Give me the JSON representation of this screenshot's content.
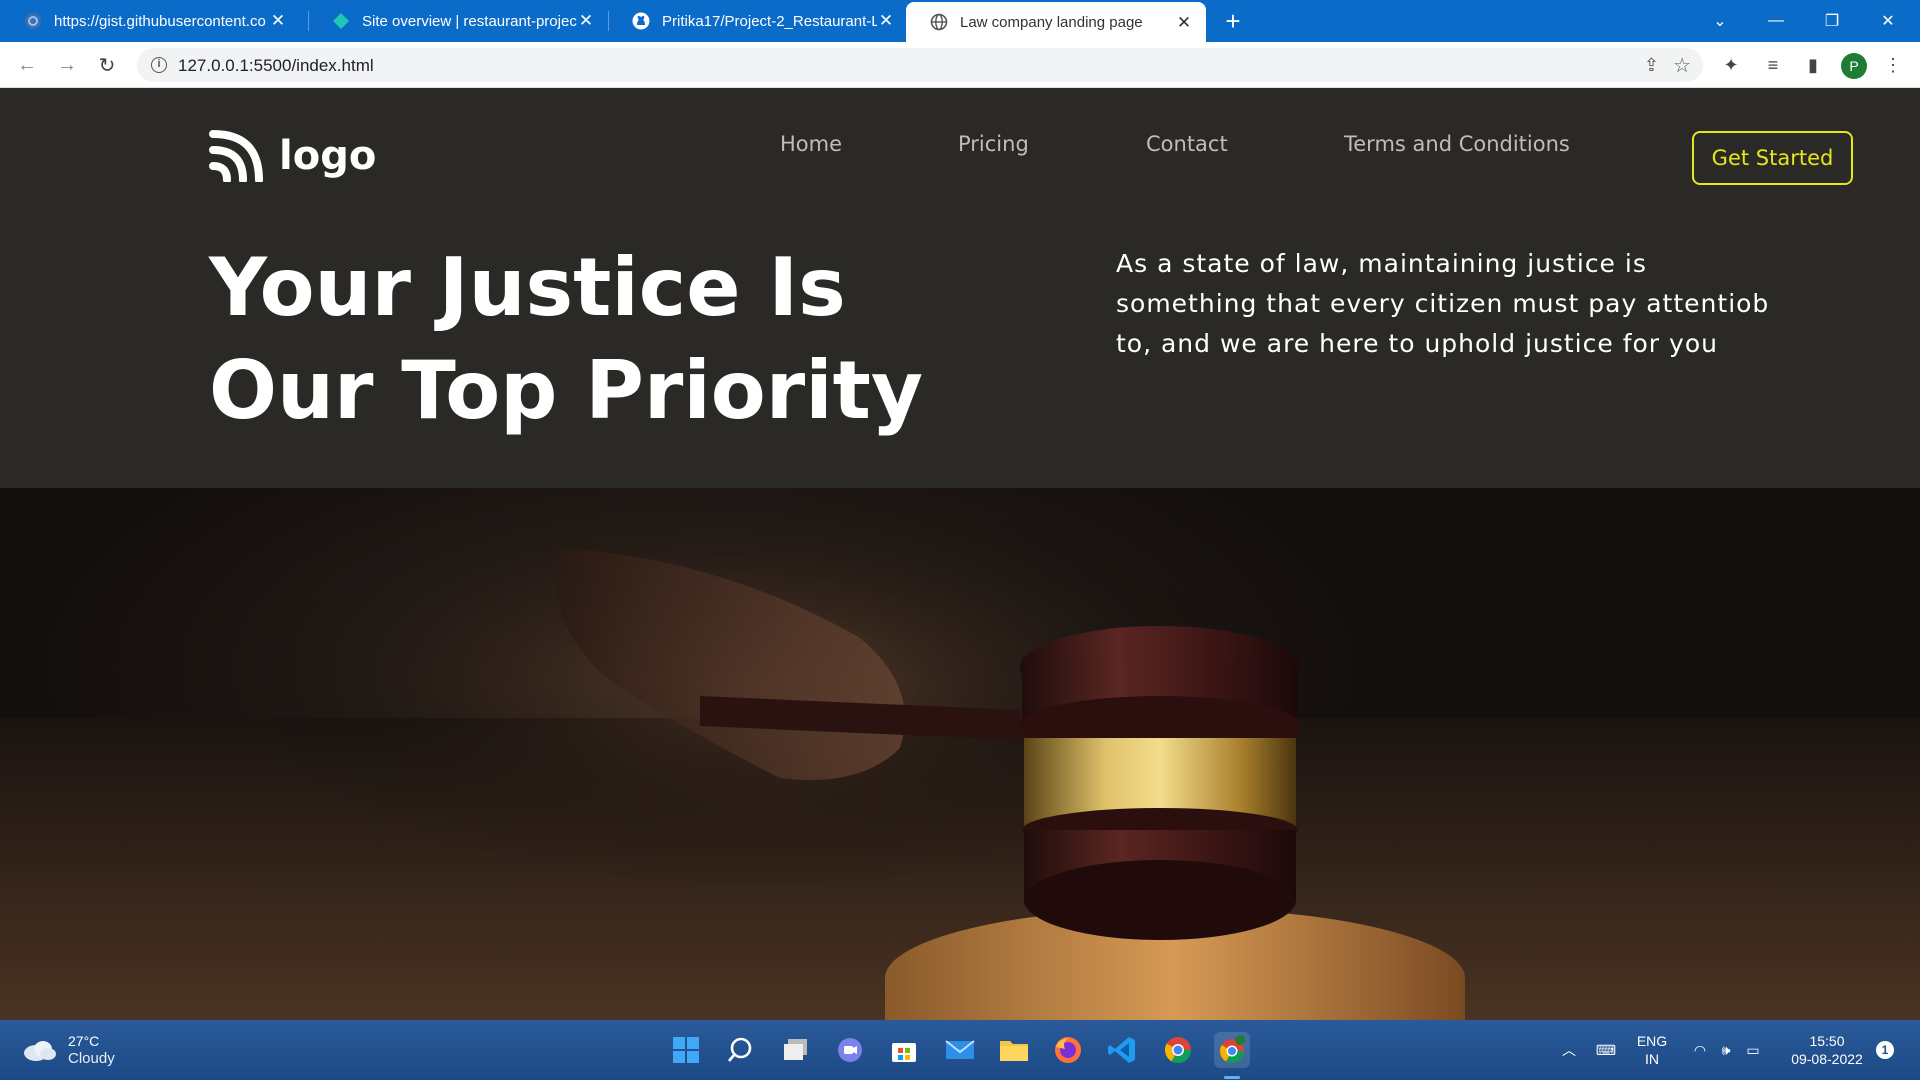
{
  "browser": {
    "tabs": [
      {
        "title": "https://gist.githubusercontent.co",
        "active": false,
        "favicon": "gist-icon"
      },
      {
        "title": "Site overview | restaurant-project",
        "active": false,
        "favicon": "netlify-icon"
      },
      {
        "title": "Pritika17/Project-2_Restaurant-L",
        "active": false,
        "favicon": "github-icon"
      },
      {
        "title": "Law company landing page",
        "active": true,
        "favicon": "globe-icon"
      }
    ],
    "url": "127.0.0.1:5500/index.html",
    "profile_initial": "P"
  },
  "site": {
    "logo_text": "logo",
    "nav": [
      "Home",
      "Pricing",
      "Contact",
      "Terms and Conditions"
    ],
    "cta_label": "Get Started",
    "headline_line1": "Your Justice Is",
    "headline_line2": "Our Top Priority",
    "subtext": "As a state of law, maintaining justice is something that every citizen must pay attentiob to, and we are here to uphold justice for you",
    "colors": {
      "background": "#2b2925",
      "accent": "#e5e51d",
      "nav_text": "#bfbdb8"
    }
  },
  "taskbar": {
    "temperature": "27°C",
    "weather": "Cloudy",
    "lang_1": "ENG",
    "lang_2": "IN",
    "time": "15:50",
    "date": "09-08-2022",
    "notification_count": "1"
  }
}
